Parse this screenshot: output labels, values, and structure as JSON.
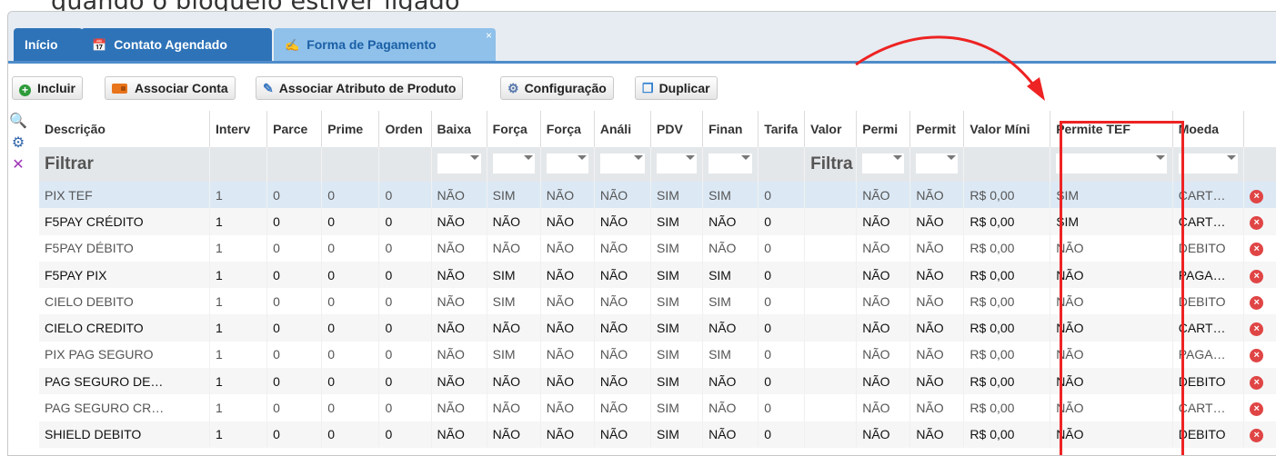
{
  "caption": "quando o bloqueio estiver ligado",
  "tabs": [
    {
      "label": "Início"
    },
    {
      "label": "Contato Agendado",
      "icon": "calendar-icon"
    },
    {
      "label": "Forma de Pagamento",
      "icon": "payment-icon",
      "close": "×"
    }
  ],
  "toolbar": {
    "incluir": "Incluir",
    "associar_conta": "Associar Conta",
    "associar_atributo": "Associar Atributo de Produto",
    "configuracao": "Configuração",
    "duplicar": "Duplicar"
  },
  "grid": {
    "columns": [
      "Descrição",
      "Interv",
      "Parce",
      "Prime",
      "Orden",
      "Baixa",
      "Força",
      "Força",
      "Análi",
      "PDV",
      "Finan",
      "Tarifa",
      "Valor",
      "Permi",
      "Permit",
      "Valor Míni",
      "Permite TEF",
      "Moeda"
    ],
    "filter_placeholder": "Filtrar",
    "filter_placeholder_short": "Filtra",
    "rows": [
      [
        "PIX TEF",
        "1",
        "0",
        "0",
        "0",
        "NÃO",
        "SIM",
        "NÃO",
        "NÃO",
        "SIM",
        "SIM",
        "0",
        "",
        "NÃO",
        "NÃO",
        "R$ 0,00",
        "SIM",
        "CART…"
      ],
      [
        "F5PAY CRÉDITO",
        "1",
        "0",
        "0",
        "0",
        "NÃO",
        "NÃO",
        "NÃO",
        "NÃO",
        "SIM",
        "NÃO",
        "0",
        "",
        "NÃO",
        "NÃO",
        "R$ 0,00",
        "SIM",
        "CART…"
      ],
      [
        "F5PAY DÉBITO",
        "1",
        "0",
        "0",
        "0",
        "NÃO",
        "NÃO",
        "NÃO",
        "NÃO",
        "SIM",
        "NÃO",
        "0",
        "",
        "NÃO",
        "NÃO",
        "R$ 0,00",
        "NÃO",
        "DEBITO"
      ],
      [
        "F5PAY PIX",
        "1",
        "0",
        "0",
        "0",
        "NÃO",
        "SIM",
        "NÃO",
        "NÃO",
        "SIM",
        "SIM",
        "0",
        "",
        "NÃO",
        "NÃO",
        "R$ 0,00",
        "NÃO",
        "PAGA…"
      ],
      [
        "CIELO DEBITO",
        "1",
        "0",
        "0",
        "0",
        "NÃO",
        "SIM",
        "NÃO",
        "NÃO",
        "SIM",
        "SIM",
        "0",
        "",
        "NÃO",
        "NÃO",
        "R$ 0,00",
        "NÃO",
        "DEBITO"
      ],
      [
        "CIELO CREDITO",
        "1",
        "0",
        "0",
        "0",
        "NÃO",
        "NÃO",
        "NÃO",
        "NÃO",
        "SIM",
        "NÃO",
        "0",
        "",
        "NÃO",
        "NÃO",
        "R$ 0,00",
        "NÃO",
        "CART…"
      ],
      [
        "PIX PAG SEGURO",
        "1",
        "0",
        "0",
        "0",
        "NÃO",
        "SIM",
        "NÃO",
        "NÃO",
        "SIM",
        "SIM",
        "0",
        "",
        "NÃO",
        "NÃO",
        "R$ 0,00",
        "NÃO",
        "PAGA…"
      ],
      [
        "PAG SEGURO DE…",
        "1",
        "0",
        "0",
        "0",
        "NÃO",
        "NÃO",
        "NÃO",
        "NÃO",
        "SIM",
        "NÃO",
        "0",
        "",
        "NÃO",
        "NÃO",
        "R$ 0,00",
        "NÃO",
        "DEBITO"
      ],
      [
        "PAG SEGURO CR…",
        "1",
        "0",
        "0",
        "0",
        "NÃO",
        "NÃO",
        "NÃO",
        "NÃO",
        "SIM",
        "NÃO",
        "0",
        "",
        "NÃO",
        "NÃO",
        "R$ 0,00",
        "NÃO",
        "CART…"
      ],
      [
        "SHIELD DEBITO",
        "1",
        "0",
        "0",
        "0",
        "NÃO",
        "NÃO",
        "NÃO",
        "NÃO",
        "SIM",
        "NÃO",
        "0",
        "",
        "NÃO",
        "NÃO",
        "R$ 0,00",
        "NÃO",
        "DEBITO"
      ]
    ],
    "dim_rows": [
      0,
      2,
      4,
      6,
      8
    ],
    "selected_row": 0,
    "dropdown_filter_columns": [
      5,
      6,
      7,
      8,
      9,
      10,
      13,
      14,
      16,
      17
    ],
    "text_filter_columns": [
      0,
      12
    ],
    "delete_icon": "delete-icon"
  },
  "annotation": {
    "highlighted_column": "Permite TEF",
    "color": "#ee2323"
  }
}
